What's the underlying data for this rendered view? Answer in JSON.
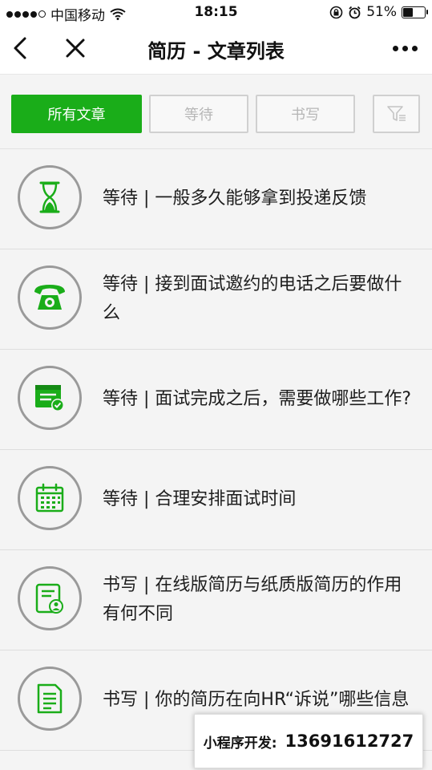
{
  "status_bar": {
    "carrier": "中国移动",
    "time": "18:15",
    "battery_percent": "51%",
    "battery_level": 0.51
  },
  "nav": {
    "title": "简历 - 文章列表"
  },
  "tabs": {
    "all": "所有文章",
    "waiting": "等待",
    "writing": "书写"
  },
  "articles": [
    {
      "title": "等待 | 一般多久能够拿到投递反馈",
      "icon": "hourglass-icon"
    },
    {
      "title": "等待 | 接到面试邀约的电话之后要做什么",
      "icon": "telephone-icon"
    },
    {
      "title": "等待 | 面试完成之后，需要做哪些工作?",
      "icon": "task-check-icon"
    },
    {
      "title": "等待 | 合理安排面试时间",
      "icon": "calendar-icon"
    },
    {
      "title": "书写 | 在线版简历与纸质版简历的作用有何不同",
      "icon": "resume-icon"
    },
    {
      "title": "书写 | 你的简历在向HR“诉说”哪些信息",
      "icon": "document-icon"
    }
  ],
  "watermark": {
    "label": "小程序开发:",
    "phone": "13691612727"
  },
  "colors": {
    "accent": "#1aad19",
    "icon_ring": "#9a9a9a",
    "tab_border": "#d0d0d0"
  }
}
